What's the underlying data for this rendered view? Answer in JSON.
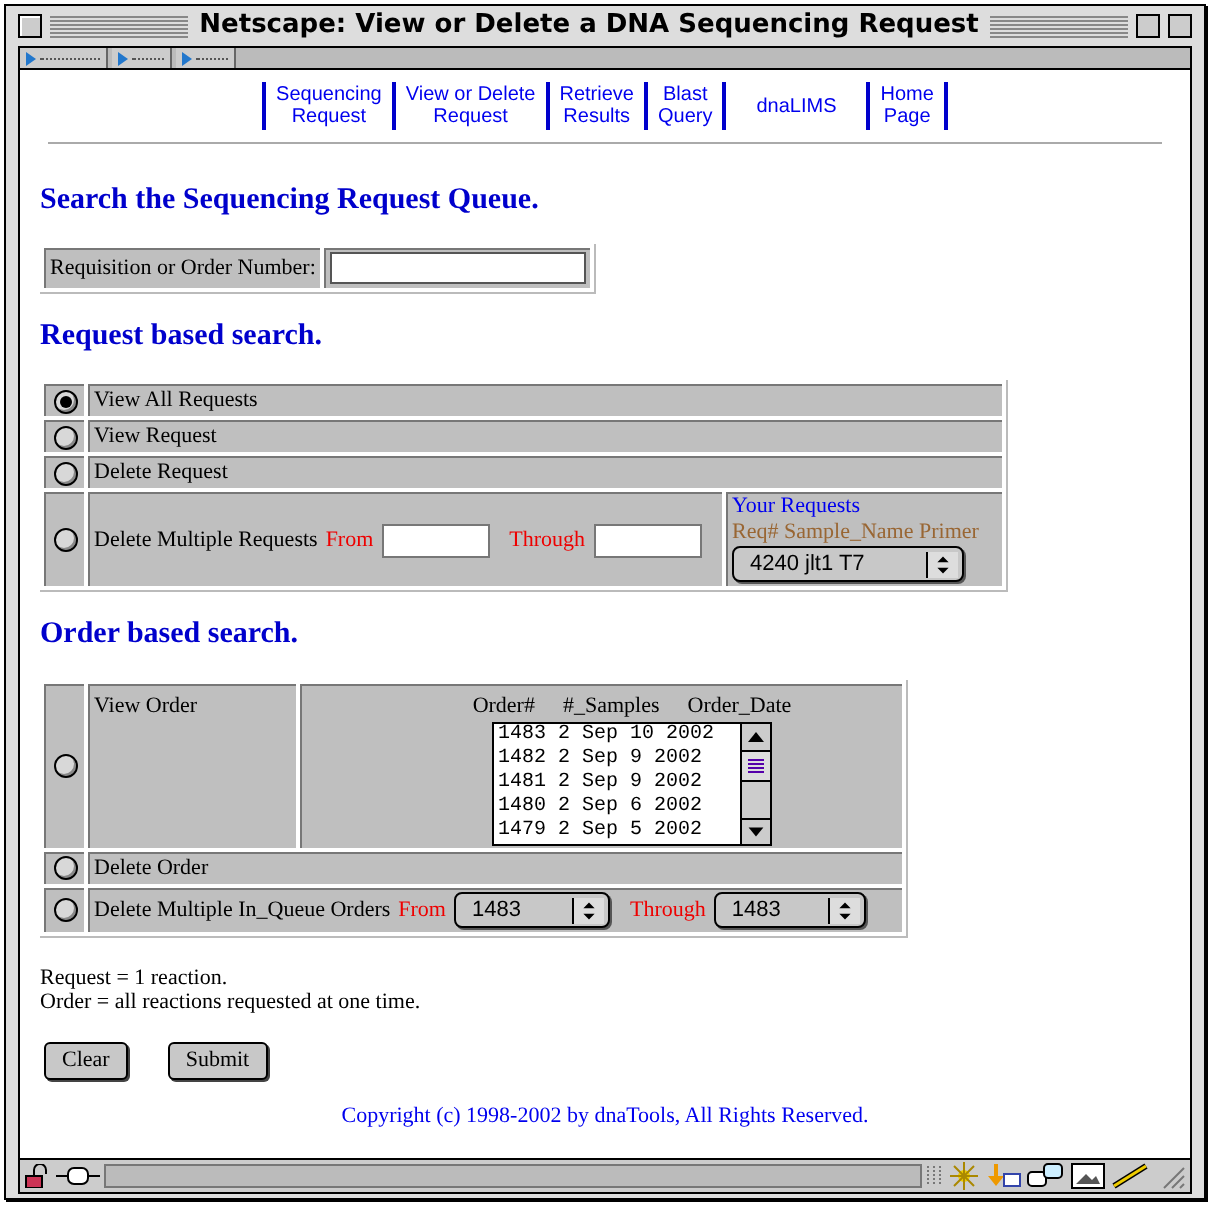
{
  "window": {
    "title": "Netscape: View or Delete a DNA Sequencing Request"
  },
  "nav": {
    "links": [
      {
        "lines": [
          "Sequencing",
          "Request"
        ]
      },
      {
        "lines": [
          "View or Delete",
          "Request"
        ]
      },
      {
        "lines": [
          "Retrieve",
          "Results"
        ]
      },
      {
        "lines": [
          "Blast",
          "Query"
        ]
      },
      {
        "lines": [
          "dnaLIMS"
        ]
      },
      {
        "lines": [
          "Home",
          "Page"
        ]
      }
    ]
  },
  "search": {
    "heading": "Search the Sequencing Request Queue.",
    "label": "Requisition or Order Number:"
  },
  "request_search": {
    "heading": "Request based search.",
    "options": [
      {
        "kind": "plain",
        "label": "View All Requests",
        "selected": true
      },
      {
        "kind": "plain",
        "label": "View Request",
        "selected": false
      },
      {
        "kind": "plain",
        "label": "Delete Request",
        "selected": false
      },
      {
        "kind": "range",
        "label": "Delete Multiple Requests",
        "from": "From",
        "through": "Through",
        "selected": false
      }
    ],
    "your_requests": {
      "title": "Your Requests",
      "header": "Req# Sample_Name Primer",
      "value": "4240 jlt1 T7"
    }
  },
  "order_search": {
    "heading": "Order based search.",
    "options": [
      {
        "kind": "list",
        "label": "View Order",
        "selected": false
      },
      {
        "kind": "plain",
        "label": "Delete Order",
        "selected": false
      },
      {
        "kind": "range",
        "label": "Delete Multiple In_Queue Orders",
        "from": "From",
        "through": "Through",
        "from_value": "1483",
        "through_value": "1483",
        "selected": false
      }
    ],
    "list": {
      "columns": [
        "Order#",
        "#_Samples",
        "Order_Date"
      ],
      "rows": [
        "1483 2 Sep 10 2002",
        "1482 2 Sep 9 2002",
        "1481 2 Sep 9 2002",
        "1480 2 Sep 6 2002",
        "1479 2 Sep 5 2002"
      ]
    }
  },
  "notes": [
    "Request = 1 reaction.",
    "Order = all reactions requested at one time."
  ],
  "buttons": [
    "Clear",
    "Submit"
  ],
  "copyright": "Copyright (c) 1998-2002 by dnaTools, All Rights Reserved."
}
